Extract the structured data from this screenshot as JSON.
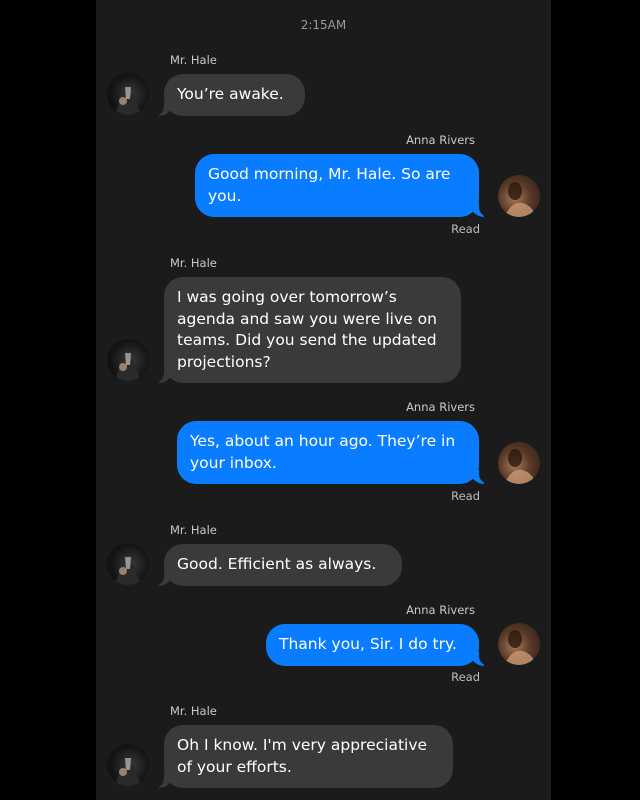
{
  "header": {
    "timestamp": "2:15AM"
  },
  "participants": {
    "hale": "Mr. Hale",
    "anna": "Anna Rivers"
  },
  "messages": [
    {
      "from": "Mr. Hale",
      "text": "You’re awake."
    },
    {
      "from": "Anna Rivers",
      "text": "Good morning, Mr. Hale. So are you.",
      "status": "Read"
    },
    {
      "from": "Mr. Hale",
      "text": "I was going over tomorrow’s agenda and saw you were live on teams. Did you send the updated projections?"
    },
    {
      "from": "Anna Rivers",
      "text": "Yes, about an hour ago. They’re in your inbox.",
      "status": "Read"
    },
    {
      "from": "Mr. Hale",
      "text": "Good. Efficient as always."
    },
    {
      "from": "Anna Rivers",
      "text": "Thank you, Sir. I do try.",
      "status": "Read"
    },
    {
      "from": "Mr. Hale",
      "text": "Oh I know. I'm very appreciative of your efforts."
    }
  ],
  "colors": {
    "incoming_bubble": "#3a3a3c",
    "outgoing_bubble": "#0a7cff",
    "background": "#1b1b1b"
  },
  "icons": {
    "hale_avatar": "avatar-mr-hale-icon",
    "anna_avatar": "avatar-anna-rivers-icon"
  }
}
